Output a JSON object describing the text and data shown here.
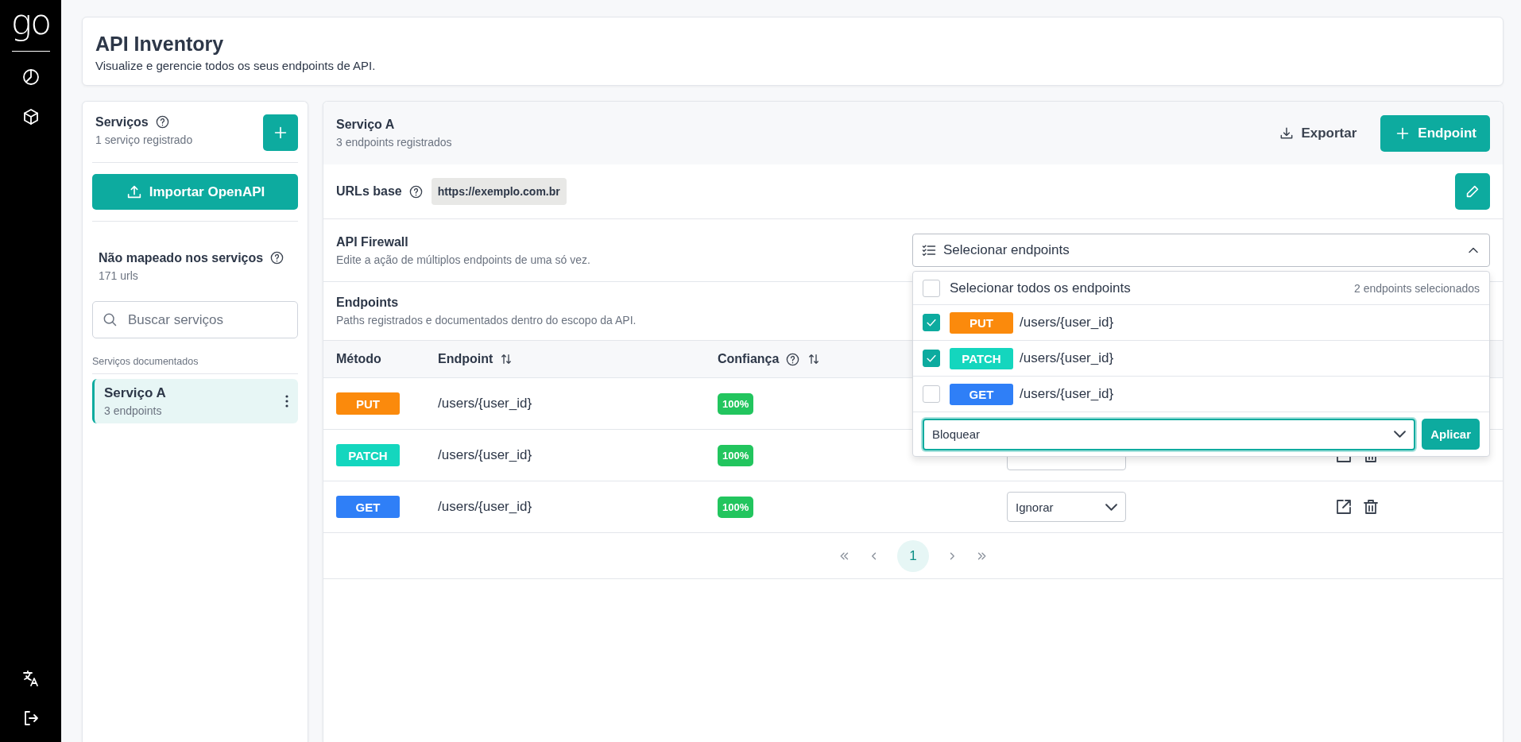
{
  "nav": {
    "logo": "go"
  },
  "header": {
    "title": "API Inventory",
    "subtitle": "Visualize e gerencie todos os seus endpoints de API."
  },
  "services_panel": {
    "title": "Serviços",
    "count": "1 serviço registrado",
    "import_button": "Importar OpenAPI",
    "unmapped": {
      "title": "Não mapeado nos serviços",
      "count": "171 urls"
    },
    "search": {
      "placeholder": "Buscar serviços"
    },
    "section_label": "Serviços documentados",
    "items": [
      {
        "name": "Serviço A",
        "count": "3 endpoints",
        "selected": true
      }
    ]
  },
  "service": {
    "title": "Serviço A",
    "subtitle": "3 endpoints registrados",
    "export_button": "Exportar",
    "add_button": "Endpoint",
    "base_urls": {
      "label": "URLs base",
      "urls": [
        "https://exemplo.com.br"
      ]
    },
    "firewall": {
      "title": "API Firewall",
      "subtitle": "Edite a ação de múltiplos endpoints de uma só vez.",
      "selector": {
        "placeholder": "Selecionar endpoints",
        "expanded": true,
        "select_all": {
          "label": "Selecionar todos os endpoints",
          "checked": false
        },
        "selected_count": "2 endpoints selecionados",
        "options": [
          {
            "method": "PUT",
            "color": "#fb8a0c",
            "path": "/users/{user_id}",
            "checked": true
          },
          {
            "method": "PATCH",
            "color": "#14d6be",
            "path": "/users/{user_id}",
            "checked": true
          },
          {
            "method": "GET",
            "color": "#2f7ff7",
            "path": "/users/{user_id}",
            "checked": false
          }
        ],
        "action": "Bloquear",
        "apply_button": "Aplicar"
      }
    },
    "endpoints": {
      "title": "Endpoints",
      "subtitle": "Paths registrados e documentados dentro do escopo da API."
    },
    "table": {
      "columns": [
        {
          "label": "Método",
          "help": false,
          "sortable": false
        },
        {
          "label": "Endpoint",
          "help": false,
          "sortable": true
        },
        {
          "label": "Confiança",
          "help": true,
          "sortable": true
        }
      ],
      "rows": [
        {
          "method": "PUT",
          "color": "#fb8a0c",
          "path": "/users/{user_id}",
          "confidence": "100%"
        },
        {
          "method": "PATCH",
          "color": "#14d6be",
          "path": "/users/{user_id}",
          "confidence": "100%",
          "has_actions": true
        },
        {
          "method": "GET",
          "color": "#2f7ff7",
          "path": "/users/{user_id}",
          "confidence": "100%",
          "has_actions": true,
          "action": "Ignorar"
        }
      ]
    },
    "pagination": {
      "pages": [
        {
          "label": "1",
          "selected": true
        }
      ]
    }
  }
}
